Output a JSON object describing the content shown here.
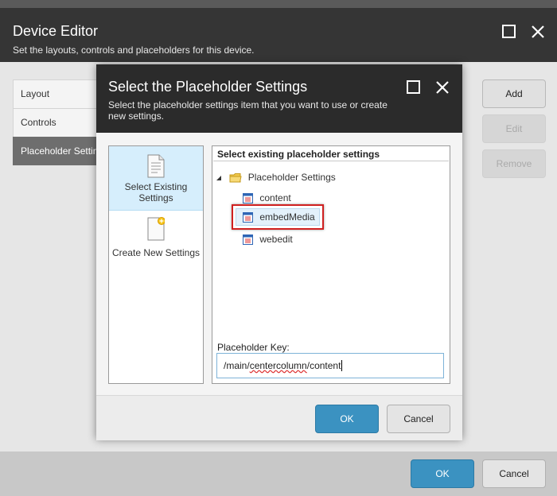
{
  "outer": {
    "title": "Device Editor",
    "subtitle": "Set the layouts, controls and placeholders for this device.",
    "nav": [
      "Layout",
      "Controls",
      "Placeholder Settings"
    ],
    "right_buttons": {
      "add": "Add",
      "edit": "Edit",
      "remove": "Remove"
    },
    "ok": "OK",
    "cancel": "Cancel"
  },
  "dialog": {
    "title": "Select the Placeholder Settings",
    "subtitle": "Select the placeholder settings item that you want to use or create new settings.",
    "options": {
      "existing": "Select Existing Settings",
      "create": "Create New Settings"
    },
    "tree_header": "Select existing placeholder settings",
    "tree": {
      "root": "Placeholder Settings",
      "items": [
        "content",
        "embedMedia",
        "webedit"
      ]
    },
    "key_label": "Placeholder Key:",
    "key_value_prefix": "/main/",
    "key_value_underlined": "centercolumn",
    "key_value_suffix": "/content",
    "ok": "OK",
    "cancel": "Cancel"
  },
  "colors": {
    "accent": "#3b92c1",
    "header": "#2b2b2b",
    "highlight": "#d02020"
  }
}
